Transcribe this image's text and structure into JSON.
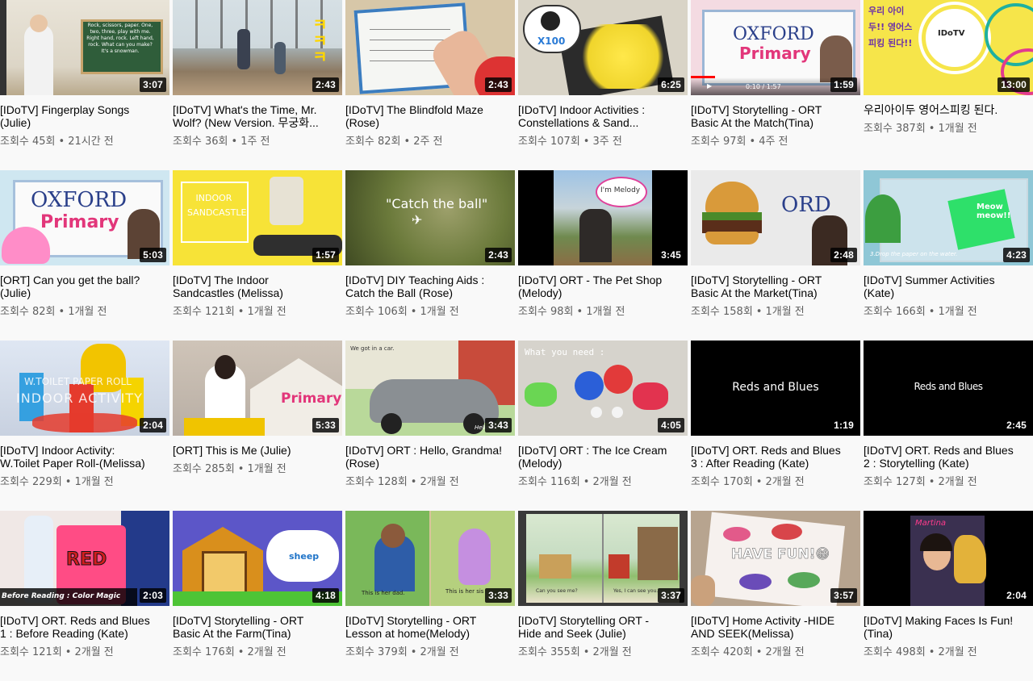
{
  "videos": [
    {
      "title": "[IDoTV] Fingerplay Songs (Julie)",
      "views": "조회수 45회",
      "age": "21시간 전",
      "duration": "3:07",
      "thumb_text": "Rock, scissors, paper. One, two, three, play with me. Right hand, rock. Left hand, rock. What can you make? It's a snowman."
    },
    {
      "title": "[IDoTV] What's the Time, Mr. Wolf? (New Version. 무궁화...",
      "views": "조회수 36회",
      "age": "1주 전",
      "duration": "2:43",
      "thumb_text": "ㅋㅋㅋ"
    },
    {
      "title": "[IDoTV] The Blindfold Maze (Rose)",
      "views": "조회수 82회",
      "age": "2주 전",
      "duration": "2:43",
      "thumb_text": ""
    },
    {
      "title": "[IDoTV] Indoor Activities : Constellations & Sand...",
      "views": "조회수 107회",
      "age": "3주 전",
      "duration": "6:25",
      "thumb_text": "X100"
    },
    {
      "title": "[IDoTV] Storytelling - ORT Basic At the Match(Tina)",
      "views": "조회수 97회",
      "age": "4주 전",
      "duration": "1:59",
      "thumb_text": "OXFORD",
      "thumb_text2": "Primary",
      "thumb_text3": "0:10 / 1:57"
    },
    {
      "title": "우리아이두 영어스피킹 된다.",
      "views": "조회수 387회",
      "age": "1개월 전",
      "duration": "13:00",
      "thumb_text": "우리 아이두!! 영어스피킹 된다!!",
      "thumb_text2": "IDoTV"
    },
    {
      "title": "[ORT] Can you get the ball? (Julie)",
      "views": "조회수 82회",
      "age": "1개월 전",
      "duration": "5:03",
      "thumb_text": "OXFORD",
      "thumb_text2": "Primary"
    },
    {
      "title": "[IDoTV] The Indoor Sandcastles (Melissa)",
      "views": "조회수 121회",
      "age": "1개월 전",
      "duration": "1:57",
      "thumb_text": "INDOOR SANDCASTLE"
    },
    {
      "title": "[IDoTV] DIY Teaching Aids : Catch the Ball (Rose)",
      "views": "조회수 106회",
      "age": "1개월 전",
      "duration": "2:43",
      "thumb_text": "\"Catch the ball\""
    },
    {
      "title": "[IDoTV] ORT - The Pet Shop (Melody)",
      "views": "조회수 98회",
      "age": "1개월 전",
      "duration": "3:45",
      "thumb_text": "I'm Melody"
    },
    {
      "title": "[IDoTV] Storytelling - ORT Basic At the Market(Tina)",
      "views": "조회수 158회",
      "age": "1개월 전",
      "duration": "2:48",
      "thumb_text": "ORD"
    },
    {
      "title": "[IDoTV] Summer Activities (Kate)",
      "views": "조회수 166회",
      "age": "1개월 전",
      "duration": "4:23",
      "thumb_text": "Meow meow!!",
      "thumb_text2": "3.Drop the paper on the water."
    },
    {
      "title": "[IDoTV] Indoor Activity: W.Toilet Paper Roll-(Melissa)",
      "views": "조회수 229회",
      "age": "1개월 전",
      "duration": "2:04",
      "thumb_text": "W.TOILET PAPER ROLL",
      "thumb_text2": "INDOOR ACTIVITY"
    },
    {
      "title": "[ORT] This is Me (Julie)",
      "views": "조회수 285회",
      "age": "1개월 전",
      "duration": "5:33",
      "thumb_text": "Primary"
    },
    {
      "title": "[IDoTV] ORT : Hello, Grandma!(Rose)",
      "views": "조회수 128회",
      "age": "2개월 전",
      "duration": "3:43",
      "thumb_text": "We got in a car.",
      "thumb_text2": "Hello Gr"
    },
    {
      "title": "[IDoTV] ORT : The Ice Cream (Melody)",
      "views": "조회수 116회",
      "age": "2개월 전",
      "duration": "4:05",
      "thumb_text": "What you need :"
    },
    {
      "title": "[IDoTV] ORT. Reds and Blues 3 : After Reading (Kate)",
      "views": "조회수 170회",
      "age": "2개월 전",
      "duration": "1:19",
      "thumb_text": "Reds and Blues"
    },
    {
      "title": "[IDoTV] ORT. Reds and Blues 2 : Storytelling (Kate)",
      "views": "조회수 127회",
      "age": "2개월 전",
      "duration": "2:45",
      "thumb_text": "Reds and Blues"
    },
    {
      "title": "[IDoTV] ORT. Reds and Blues 1 : Before Reading (Kate)",
      "views": "조회수 121회",
      "age": "2개월 전",
      "duration": "2:03",
      "thumb_text": "RED",
      "thumb_text2": "Before Reading : Color Magic"
    },
    {
      "title": "[IDoTV] Storytelling - ORT Basic At the Farm(Tina)",
      "views": "조회수 176회",
      "age": "2개월 전",
      "duration": "4:18",
      "thumb_text": "sheep"
    },
    {
      "title": "[IDoTV] Storytelling - ORT Lesson at home(Melody)",
      "views": "조회수 379회",
      "age": "2개월 전",
      "duration": "3:33",
      "thumb_text": "This is her dad.",
      "thumb_text2": "This is her sis"
    },
    {
      "title": "[IDoTV] Storytelling ORT - Hide and Seek (Julie)",
      "views": "조회수 355회",
      "age": "2개월 전",
      "duration": "3:37",
      "thumb_text": "Can you see me?",
      "thumb_text2": "Yes, I can see you."
    },
    {
      "title": "[IDoTV] Home Activity -HIDE AND SEEK(Melissa)",
      "views": "조회수 420회",
      "age": "2개월 전",
      "duration": "3:57",
      "thumb_text": "HAVE FUN!😁"
    },
    {
      "title": "[IDoTV] Making Faces Is Fun! (Tina)",
      "views": "조회수 498회",
      "age": "2개월 전",
      "duration": "2:04",
      "thumb_text": "Martina"
    }
  ]
}
